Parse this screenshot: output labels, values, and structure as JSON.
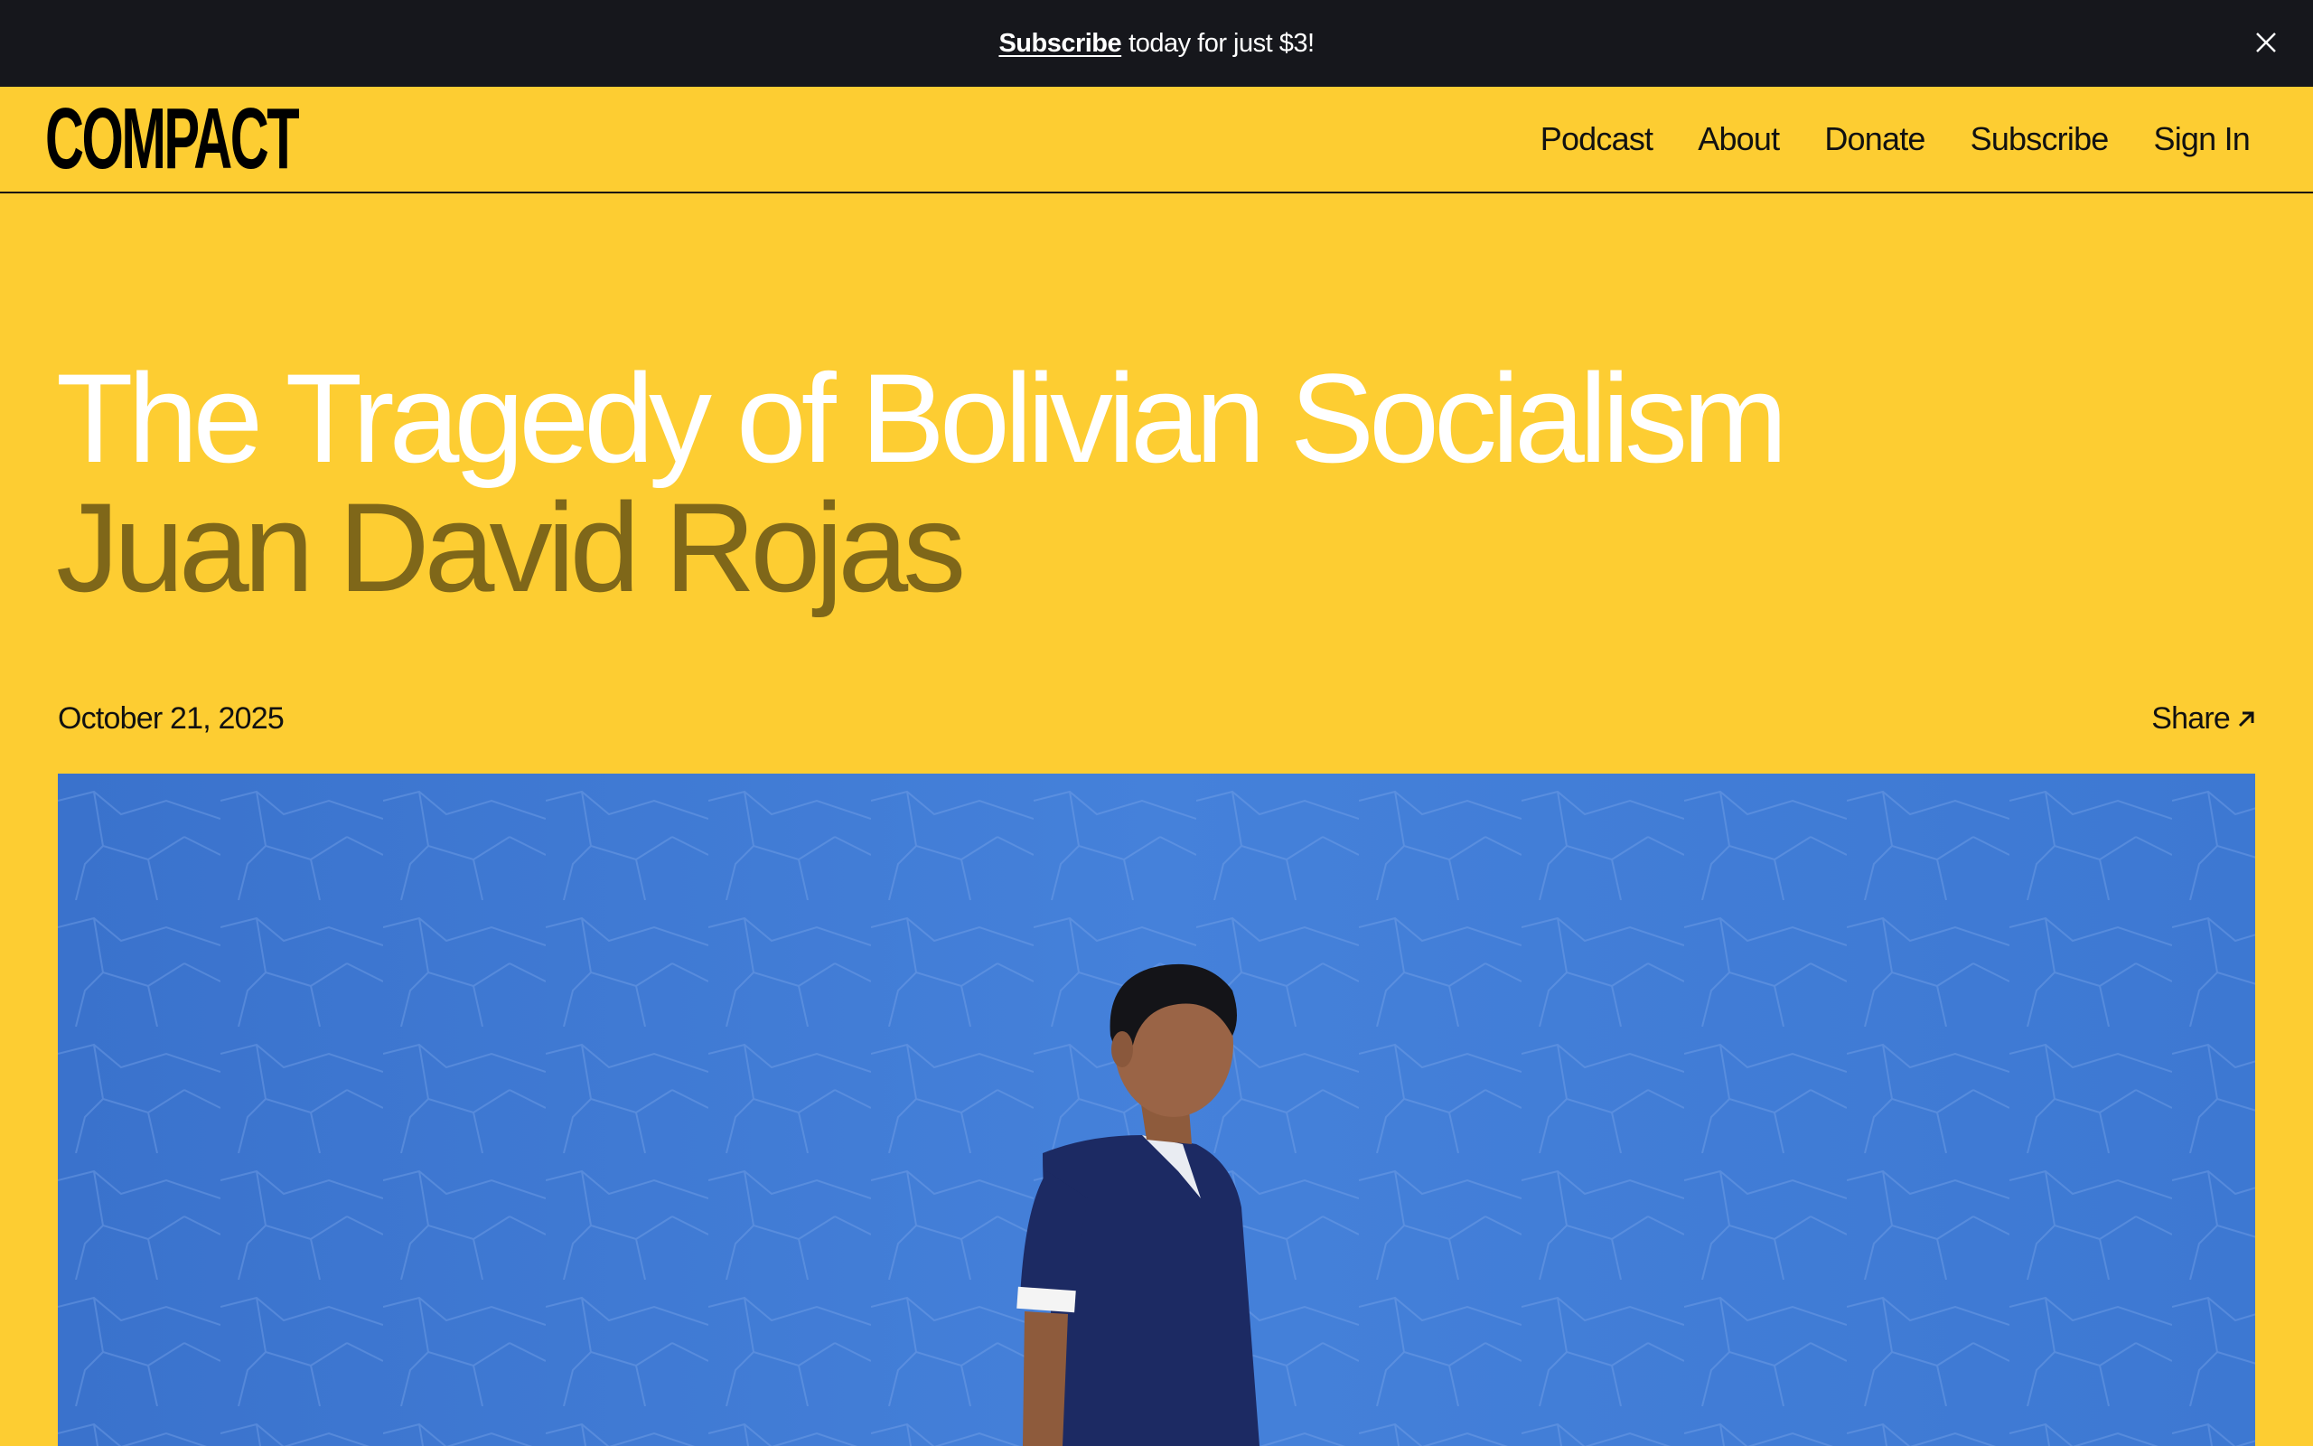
{
  "promo": {
    "link_label": "Subscribe",
    "text": "today for just $3!"
  },
  "header": {
    "logo": "COMPACT",
    "nav": [
      "Podcast",
      "About",
      "Donate",
      "Subscribe",
      "Sign In"
    ]
  },
  "article": {
    "title": "The Tragedy of Bolivian Socialism",
    "author": "Juan David Rojas",
    "date": "October 21, 2025",
    "share_label": "Share",
    "hero_image": "photo of a man in a navy polo shirt walking past a blue wall"
  },
  "colors": {
    "page_background": "#fdcd32",
    "promo_background": "#16171c",
    "title": "#ffffff",
    "author": "#7f6719",
    "hero_wall": "#3d78d4"
  },
  "icons": [
    "close-icon",
    "arrow-up-right-icon"
  ]
}
